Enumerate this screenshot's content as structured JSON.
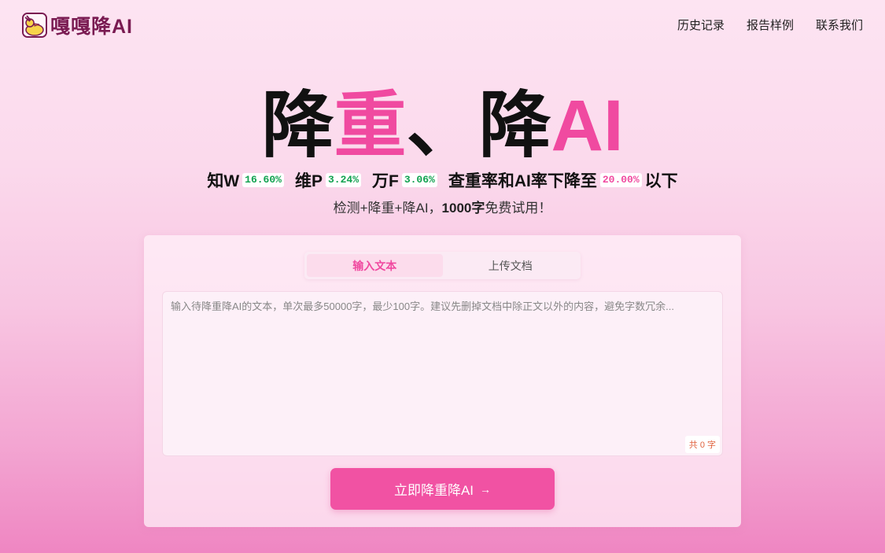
{
  "header": {
    "logo_text": "嘎嘎降AI",
    "nav": [
      "历史记录",
      "报告样例",
      "联系我们"
    ]
  },
  "hero": {
    "title_part1": "降",
    "title_part2": "重",
    "title_part3": "、降",
    "title_part4": "AI"
  },
  "subline": {
    "platform1": "知W",
    "platform1_rate": "16.60%",
    "platform2": "维P",
    "platform2_rate": "3.24%",
    "platform3": "万F",
    "platform3_rate": "3.06%",
    "claim": "查重率和AI率下降至",
    "target_rate": "20.00%",
    "suffix": "以下"
  },
  "tagline": {
    "prefix": "检测+降重+降AI，",
    "highlight": "1000字",
    "suffix": "免费试用！"
  },
  "card": {
    "tabs": [
      "输入文本",
      "上传文档"
    ],
    "active_tab": "输入文本",
    "input_placeholder": "输入待降重降AI的文本，单次最多50000字，最少100字。建议先删掉文档中除正文以外的内容，避免字数冗余...",
    "input_value": "",
    "counter": "共 0 字",
    "submit_label": "立即降重降AI",
    "submit_icon": "arrow-right-icon"
  },
  "colors": {
    "accent": "#f04aa0",
    "brand_dark": "#7a1b52",
    "green": "#12a150",
    "counter": "#e0633f"
  }
}
